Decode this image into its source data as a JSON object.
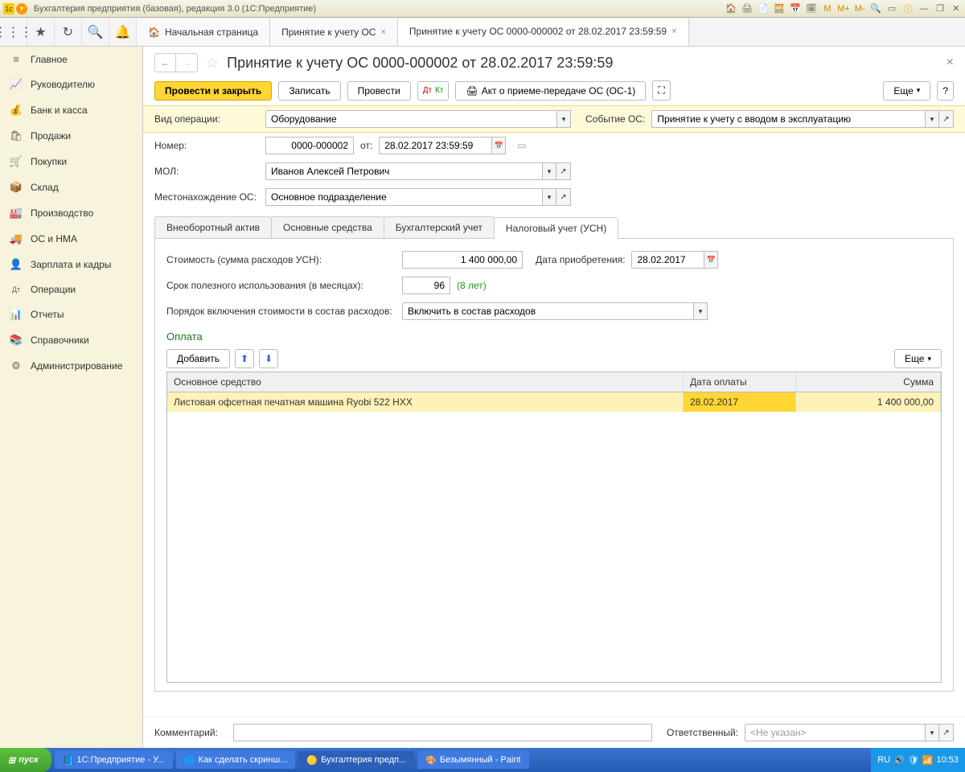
{
  "window": {
    "title": "Бухгалтерия предприятия (базовая), редакция 3.0  (1С:Предприятие)"
  },
  "tabs": {
    "home": "Начальная страница",
    "t1": "Принятие к учету ОС",
    "t2": "Принятие к учету ОС 0000-000002 от 28.02.2017 23:59:59"
  },
  "sidebar": {
    "items": [
      {
        "icon": "≡",
        "label": "Главное"
      },
      {
        "icon": "📈",
        "label": "Руководителю"
      },
      {
        "icon": "💰",
        "label": "Банк и касса"
      },
      {
        "icon": "🛍",
        "label": "Продажи"
      },
      {
        "icon": "🛒",
        "label": "Покупки"
      },
      {
        "icon": "📦",
        "label": "Склад"
      },
      {
        "icon": "🏭",
        "label": "Производство"
      },
      {
        "icon": "🚚",
        "label": "ОС и НМА"
      },
      {
        "icon": "👤",
        "label": "Зарплата и кадры"
      },
      {
        "icon": "Дт",
        "label": "Операции"
      },
      {
        "icon": "📊",
        "label": "Отчеты"
      },
      {
        "icon": "📚",
        "label": "Справочники"
      },
      {
        "icon": "⚙",
        "label": "Администрирование"
      }
    ]
  },
  "doc": {
    "title": "Принятие к учету ОС 0000-000002 от 28.02.2017 23:59:59",
    "cmd": {
      "post_close": "Провести и закрыть",
      "write": "Записать",
      "post": "Провести",
      "act": "Акт о приеме-передаче ОС (ОС-1)",
      "more": "Еще"
    },
    "labels": {
      "op_type": "Вид операции:",
      "event": "Событие ОС:",
      "number": "Номер:",
      "from": "от:",
      "mol": "МОЛ:",
      "location": "Местонахождение ОС:",
      "comment": "Комментарий:",
      "responsible": "Ответственный:"
    },
    "values": {
      "op_type": "Оборудование",
      "event": "Принятие к учету с вводом в эксплуатацию",
      "number": "0000-000002",
      "date": "28.02.2017 23:59:59",
      "mol": "Иванов Алексей Петрович",
      "location": "Основное подразделение",
      "comment": "",
      "responsible": "<Не указан>"
    },
    "inner_tabs": {
      "t0": "Внеоборотный актив",
      "t1": "Основные средства",
      "t2": "Бухгалтерский учет",
      "t3": "Налоговый учет (УСН)"
    },
    "usn": {
      "cost_label": "Стоимость (сумма расходов УСН):",
      "cost": "1 400 000,00",
      "acq_date_label": "Дата приобретения:",
      "acq_date": "28.02.2017",
      "life_label": "Срок полезного использования (в месяцах):",
      "life": "96",
      "life_hint": "(8 лет)",
      "order_label": "Порядок включения стоимости в состав расходов:",
      "order": "Включить в состав расходов",
      "payment_title": "Оплата",
      "add": "Добавить",
      "more": "Еще",
      "cols": {
        "name": "Основное средство",
        "date": "Дата оплаты",
        "sum": "Сумма"
      },
      "row": {
        "name": "Листовая офсетная печатная машина Ryobi 522 HXX",
        "date": "28.02.2017",
        "sum": "1 400 000,00"
      }
    }
  },
  "taskbar": {
    "start": "пуск",
    "items": [
      "1С:Предприятие - У...",
      "Как сделать скринш...",
      "Бухгалтерия предп...",
      "Безымянный - Paint"
    ],
    "lang": "RU",
    "time": "10:53"
  }
}
